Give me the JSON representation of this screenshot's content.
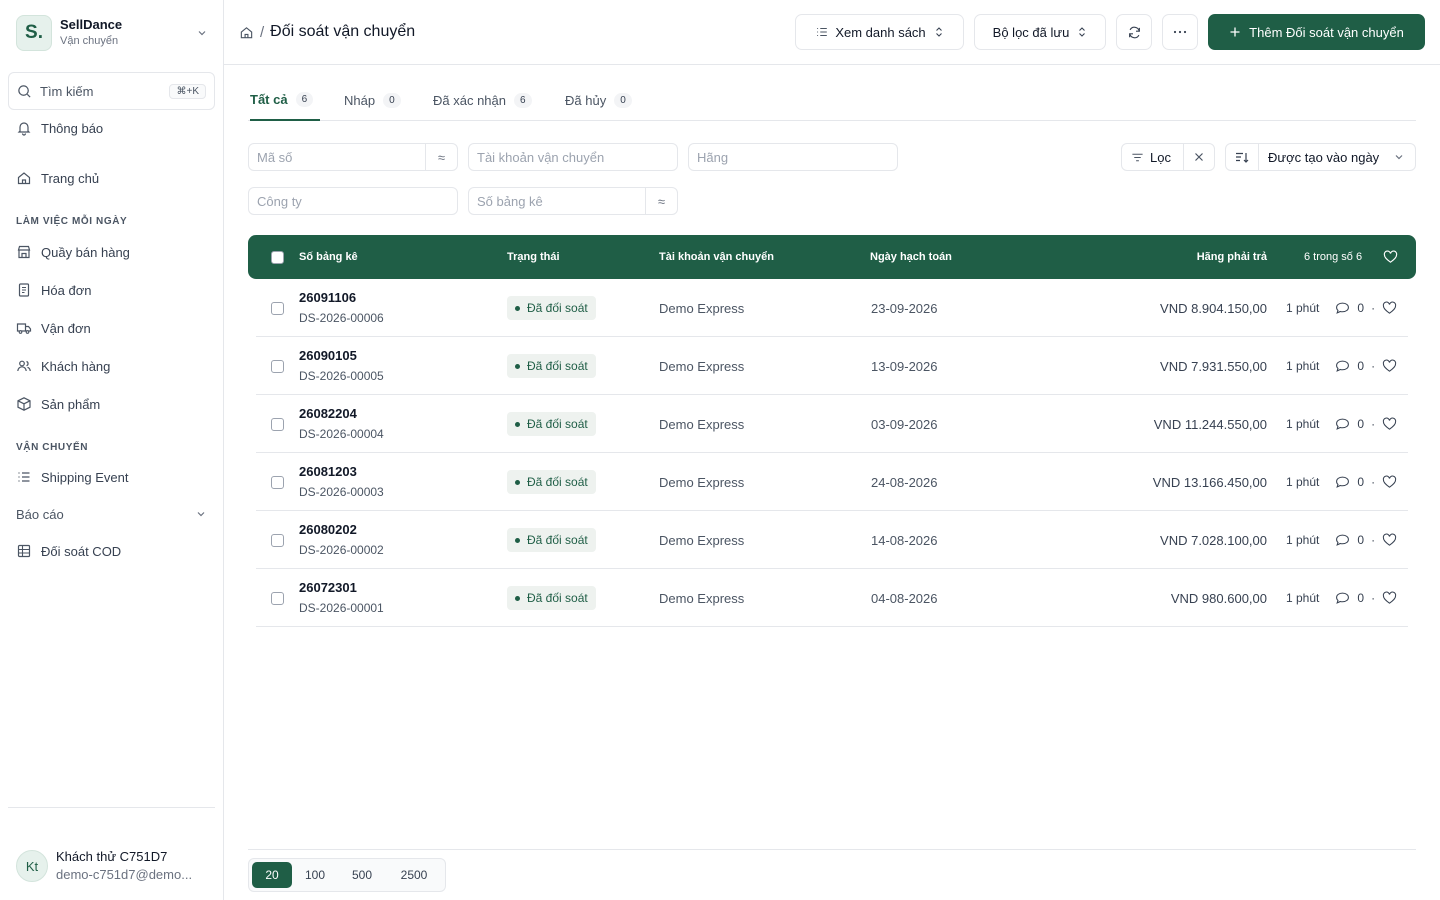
{
  "sidebar": {
    "brand_initial": "S.",
    "brand_name": "SellDance",
    "brand_sub": "Vận chuyển",
    "search_label": "Tìm kiếm",
    "search_shortcut": "⌘+K",
    "notifications": "Thông báo",
    "home": "Trang chủ",
    "section_daily": "LÀM VIỆC MỖI NGÀY",
    "pos": "Quầy bán hàng",
    "invoices": "Hóa đơn",
    "shipments": "Vận đơn",
    "customers": "Khách hàng",
    "products": "Sản phẩm",
    "section_shipping": "VẬN CHUYỂN",
    "shipping_event": "Shipping Event",
    "reports": "Báo cáo",
    "cod": "Đối soát COD"
  },
  "user": {
    "initials": "Kt",
    "name": "Khách thử C751D7",
    "email": "demo-c751d7@demo..."
  },
  "header": {
    "title": "Đối soát vận chuyển",
    "view_list": "Xem danh sách",
    "saved_filters": "Bộ lọc đã lưu",
    "add_button": "Thêm Đối soát vận chuyển"
  },
  "tabs": [
    {
      "label": "Tất cả",
      "count": "6"
    },
    {
      "label": "Nháp",
      "count": "0"
    },
    {
      "label": "Đã xác nhận",
      "count": "6"
    },
    {
      "label": "Đã hủy",
      "count": "0"
    }
  ],
  "filters": {
    "code_placeholder": "Mã số",
    "account_placeholder": "Tài khoản vận chuyển",
    "carrier_placeholder": "Hãng",
    "company_placeholder": "Công ty",
    "statement_placeholder": "Số bảng kê",
    "like_op": "≈",
    "filter_label": "Lọc",
    "sort_label": "Được tạo vào ngày"
  },
  "table": {
    "columns": {
      "number": "Số bảng kê",
      "status": "Trạng thái",
      "account": "Tài khoản vận chuyển",
      "date": "Ngày hạch toán",
      "payable": "Hãng phải trả",
      "count": "6 trong số 6"
    },
    "rows": [
      {
        "number": "26091106",
        "code": "DS-2026-00006",
        "status": "Đã đối soát",
        "account": "Demo Express",
        "date": "23-09-2026",
        "amount": "VND 8.904.150,00",
        "time": "1 phút",
        "comments": "0"
      },
      {
        "number": "26090105",
        "code": "DS-2026-00005",
        "status": "Đã đối soát",
        "account": "Demo Express",
        "date": "13-09-2026",
        "amount": "VND 7.931.550,00",
        "time": "1 phút",
        "comments": "0"
      },
      {
        "number": "26082204",
        "code": "DS-2026-00004",
        "status": "Đã đối soát",
        "account": "Demo Express",
        "date": "03-09-2026",
        "amount": "VND 11.244.550,00",
        "time": "1 phút",
        "comments": "0"
      },
      {
        "number": "26081203",
        "code": "DS-2026-00003",
        "status": "Đã đối soát",
        "account": "Demo Express",
        "date": "24-08-2026",
        "amount": "VND 13.166.450,00",
        "time": "1 phút",
        "comments": "0"
      },
      {
        "number": "26080202",
        "code": "DS-2026-00002",
        "status": "Đã đối soát",
        "account": "Demo Express",
        "date": "14-08-2026",
        "amount": "VND 7.028.100,00",
        "time": "1 phút",
        "comments": "0"
      },
      {
        "number": "26072301",
        "code": "DS-2026-00001",
        "status": "Đã đối soát",
        "account": "Demo Express",
        "date": "04-08-2026",
        "amount": "VND 980.600,00",
        "time": "1 phút",
        "comments": "0"
      }
    ]
  },
  "pagination": {
    "sizes": [
      "20",
      "100",
      "500",
      "2500"
    ],
    "selected": "20"
  },
  "colors": {
    "accent": "#1f5e46",
    "status_bg": "#eef2ef"
  }
}
